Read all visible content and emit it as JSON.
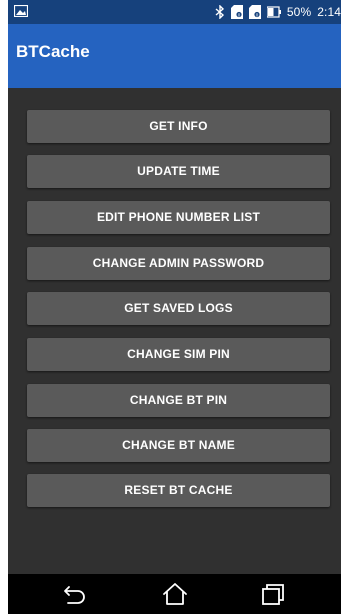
{
  "status_bar": {
    "battery_percent": "50%",
    "time": "2:14",
    "icons": [
      "image-notification-icon",
      "bluetooth-icon",
      "sim-card-icon",
      "sim-card-icon",
      "battery-icon"
    ]
  },
  "app_bar": {
    "title": "BTCache"
  },
  "buttons": [
    {
      "label": "GET INFO"
    },
    {
      "label": "UPDATE TIME"
    },
    {
      "label": "EDIT PHONE NUMBER LIST"
    },
    {
      "label": "CHANGE ADMIN PASSWORD"
    },
    {
      "label": "GET SAVED LOGS"
    },
    {
      "label": "CHANGE SIM PIN"
    },
    {
      "label": "CHANGE BT PIN"
    },
    {
      "label": "CHANGE BT NAME"
    },
    {
      "label": "RESET BT CACHE"
    }
  ],
  "nav_bar": {
    "icons": [
      "back-icon",
      "home-icon",
      "recent-apps-icon"
    ]
  },
  "colors": {
    "status_bar": "#16417c",
    "app_bar": "#2563c0",
    "background": "#303030",
    "button": "#5a5a5a",
    "nav_bar": "#000000"
  }
}
